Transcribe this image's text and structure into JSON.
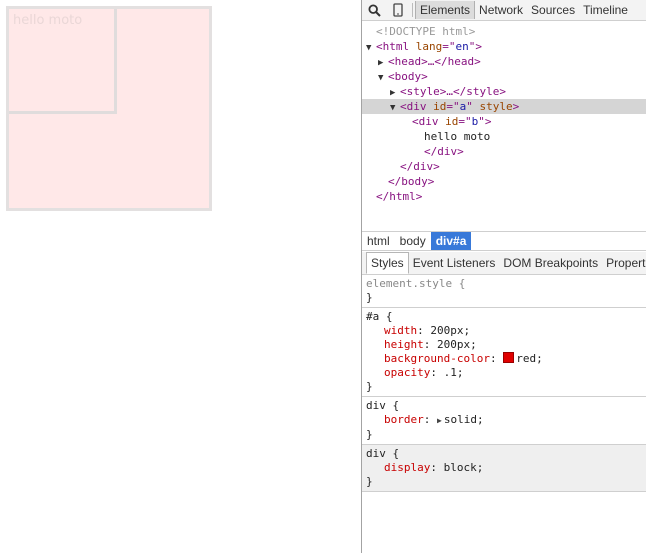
{
  "page": {
    "box_text": "hello moto"
  },
  "toolbar": {
    "tabs": [
      "Elements",
      "Network",
      "Sources",
      "Timeline"
    ]
  },
  "dom_tree": {
    "lines": [
      {
        "indent": 0,
        "tri": "",
        "parts": [
          {
            "c": "comment",
            "t": "<!DOCTYPE html>"
          }
        ]
      },
      {
        "indent": 0,
        "tri": "▼",
        "parts": [
          {
            "c": "tag",
            "t": "<html "
          },
          {
            "c": "attr",
            "t": "lang"
          },
          {
            "c": "tag",
            "t": "=\""
          },
          {
            "c": "val",
            "t": "en"
          },
          {
            "c": "tag",
            "t": "\">"
          }
        ]
      },
      {
        "indent": 1,
        "tri": "▶",
        "parts": [
          {
            "c": "tag",
            "t": "<head>…</head>"
          }
        ]
      },
      {
        "indent": 1,
        "tri": "▼",
        "parts": [
          {
            "c": "tag",
            "t": "<body>"
          }
        ]
      },
      {
        "indent": 2,
        "tri": "▶",
        "parts": [
          {
            "c": "tag",
            "t": "<style>…</style>"
          }
        ]
      },
      {
        "indent": 2,
        "tri": "▼",
        "selected": true,
        "parts": [
          {
            "c": "tag",
            "t": "<div "
          },
          {
            "c": "attr",
            "t": "id"
          },
          {
            "c": "tag",
            "t": "=\""
          },
          {
            "c": "val",
            "t": "a"
          },
          {
            "c": "tag",
            "t": "\" "
          },
          {
            "c": "attr",
            "t": "style"
          },
          {
            "c": "tag",
            "t": ">"
          }
        ]
      },
      {
        "indent": 3,
        "tri": "",
        "parts": [
          {
            "c": "tag",
            "t": "<div "
          },
          {
            "c": "attr",
            "t": "id"
          },
          {
            "c": "tag",
            "t": "=\""
          },
          {
            "c": "val",
            "t": "b"
          },
          {
            "c": "tag",
            "t": "\">"
          }
        ]
      },
      {
        "indent": 4,
        "tri": "",
        "parts": [
          {
            "c": "txt",
            "t": "hello moto"
          }
        ]
      },
      {
        "indent": 4,
        "tri": "",
        "parts": [
          {
            "c": "tag",
            "t": "</div>"
          }
        ]
      },
      {
        "indent": 2,
        "tri": "",
        "parts": [
          {
            "c": "tag",
            "t": "</div>"
          }
        ]
      },
      {
        "indent": 1,
        "tri": "",
        "parts": [
          {
            "c": "tag",
            "t": "</body>"
          }
        ]
      },
      {
        "indent": 0,
        "tri": "",
        "parts": [
          {
            "c": "tag",
            "t": "</html>"
          }
        ]
      }
    ]
  },
  "breadcrumbs": [
    "html",
    "body",
    "div#a"
  ],
  "sub_tabs": [
    "Styles",
    "Event Listeners",
    "DOM Breakpoints",
    "Properties"
  ],
  "styles": {
    "rules": [
      {
        "selector": "element.style {",
        "dim": true,
        "gray": false,
        "props": []
      },
      {
        "selector": "#a {",
        "dim": false,
        "gray": false,
        "props": [
          {
            "name": "width",
            "value": "200px;"
          },
          {
            "name": "height",
            "value": "200px;"
          },
          {
            "name": "background-color",
            "value": "red;",
            "swatch": "#e00000"
          },
          {
            "name": "opacity",
            "value": ".1;"
          }
        ]
      },
      {
        "selector": "div {",
        "dim": false,
        "gray": false,
        "props": [
          {
            "name": "border",
            "value": "solid;",
            "expander": true
          }
        ]
      },
      {
        "selector": "div {",
        "dim": false,
        "gray": true,
        "props": [
          {
            "name": "display",
            "value": "block;"
          }
        ]
      }
    ],
    "closing": "}"
  }
}
